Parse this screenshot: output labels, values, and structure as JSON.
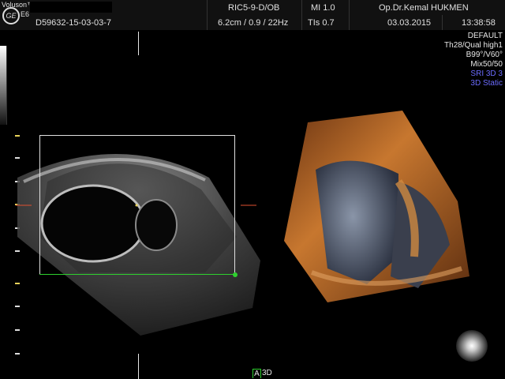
{
  "header": {
    "brand": "Voluson™",
    "model": "E6",
    "patient_id": "D59632-15-03-03-7",
    "probe": "RIC5-9-D/OB",
    "depth_info": "6.2cm / 0.9 / 22Hz",
    "mi": "MI  1.0",
    "tis": "TIs  0.7",
    "doctor": "Op.Dr.Kemal HUKMEN",
    "date": "03.03.2015",
    "time": "13:38:58"
  },
  "params": [
    {
      "text": "DEFAULT",
      "color": "#e6e6e6"
    },
    {
      "text": "Th28/Qual high1",
      "color": "#e6e6e6"
    },
    {
      "text": "B99°/V60°",
      "color": "#e6e6e6"
    },
    {
      "text": "Mix50/50",
      "color": "#e6e6e6"
    },
    {
      "text": "SRI 3D 3",
      "color": "#6b6bff"
    },
    {
      "text": "3D Static",
      "color": "#6b6bff"
    }
  ],
  "bottom": {
    "label_a": "A",
    "label_3d": "3D"
  },
  "icons": {
    "logo": "ge-logo-icon",
    "probe_orientation": "probe-orientation-icon"
  },
  "colors": {
    "accent_green": "#2ed02e",
    "accent_blue": "#6b6bff",
    "render_orange": "#c7772f"
  }
}
